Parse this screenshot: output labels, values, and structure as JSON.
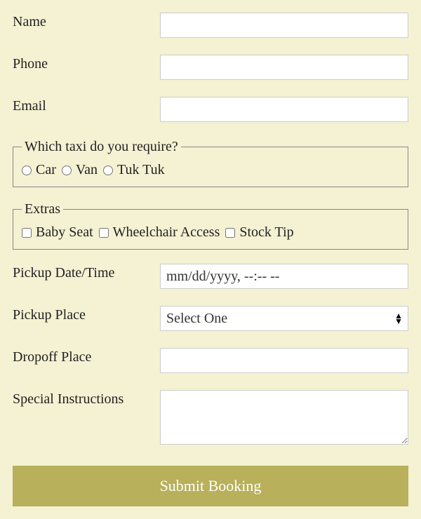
{
  "fields": {
    "name_label": "Name",
    "phone_label": "Phone",
    "email_label": "Email",
    "pickup_datetime_label": "Pickup Date/Time",
    "pickup_datetime_placeholder": "mm/dd/yyyy, --:-- --",
    "pickup_place_label": "Pickup Place",
    "dropoff_place_label": "Dropoff Place",
    "special_instructions_label": "Special Instructions"
  },
  "taxi_fieldset": {
    "legend": "Which taxi do you require?",
    "options": {
      "car": "Car",
      "van": "Van",
      "tuktuk": "Tuk Tuk"
    }
  },
  "extras_fieldset": {
    "legend": "Extras",
    "options": {
      "baby_seat": "Baby Seat",
      "wheelchair": "Wheelchair Access",
      "stock_tip": "Stock Tip"
    }
  },
  "pickup_place_select": {
    "placeholder": "Select One"
  },
  "submit_label": "Submit Booking"
}
